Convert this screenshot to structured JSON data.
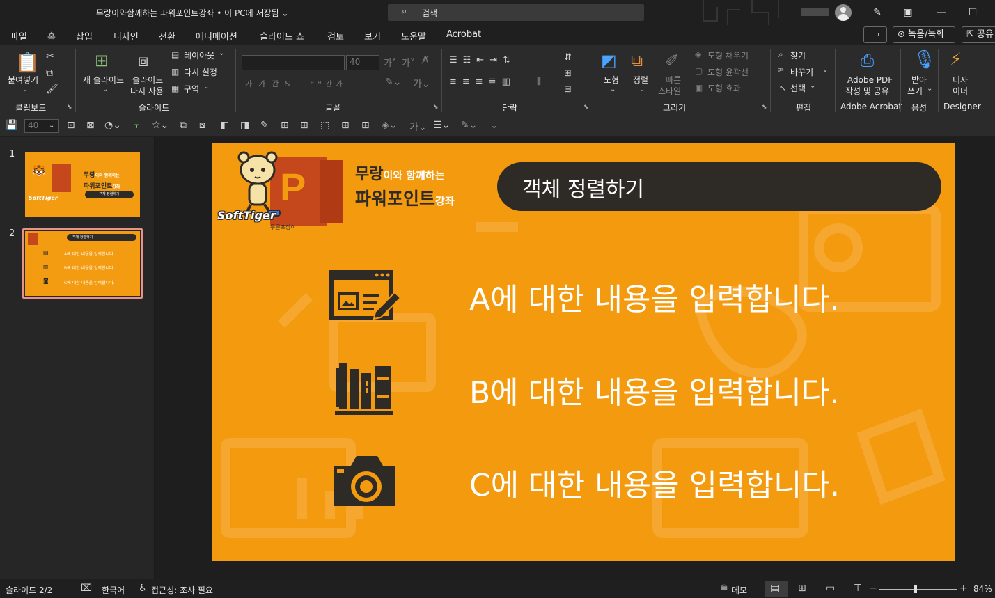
{
  "window": {
    "title": "무랑이와함께하는 파워포인트강좌 • 이 PC에 저장됨",
    "search_placeholder": "검색"
  },
  "menu": {
    "tabs": [
      "파일",
      "홈",
      "삽입",
      "디자인",
      "전환",
      "애니메이션",
      "슬라이드 쇼",
      "검토",
      "보기",
      "도움말",
      "Acrobat"
    ],
    "active_tab": "홈",
    "record_label": "녹음/녹화",
    "share_label": "공유"
  },
  "ribbon": {
    "clipboard": {
      "group": "클립보드",
      "paste": "붙여넣기"
    },
    "slides": {
      "group": "슬라이드",
      "new_slide_1": "새 슬라이드",
      "reuse_1": "슬라이드",
      "reuse_2": "다시 사용",
      "layout": "레이아웃",
      "reset": "다시 설정",
      "section": "구역"
    },
    "font": {
      "group": "글꼴",
      "size": "40"
    },
    "paragraph": {
      "group": "단락"
    },
    "drawing": {
      "group": "그리기",
      "shape": "도형",
      "arrange": "정렬",
      "quick_1": "빠른",
      "quick_2": "스타일",
      "fill": "도형 채우기",
      "outline": "도형 윤곽선",
      "effect": "도형 효과"
    },
    "editing": {
      "group": "편집",
      "find": "찾기",
      "replace": "바꾸기",
      "select": "선택"
    },
    "adobe": {
      "group": "Adobe Acrobat",
      "line1": "Adobe PDF",
      "line2": "작성 및 공유"
    },
    "voice": {
      "group": "음성",
      "line1": "받아",
      "line2": "쓰기"
    },
    "designer": {
      "group": "Designer",
      "line1": "디자",
      "line2": "이너"
    }
  },
  "qat": {
    "size": "40"
  },
  "thumbnails": {
    "slides": [
      {
        "number": "1",
        "title_a": "무랑",
        "title_b": "이와 함께하는",
        "title_c": "파워포인트",
        "title_d": "강좌",
        "pill": "객체 정렬하기",
        "brand": "SoftTiger"
      },
      {
        "number": "2",
        "pill": "객체 정렬하기",
        "line_a": "A에 대한 내용을 입력합니다.",
        "line_b": "B에 대한 내용을 입력합니다.",
        "line_c": "C에 대한 내용을 입력합니다."
      }
    ]
  },
  "slide": {
    "logo_title_big": "무랑",
    "logo_title_small": "이와 함께하는",
    "logo_title_line2": "파워포인트",
    "logo_title_line2_small": "강좌",
    "brand": "SoftTiger",
    "brand_sub": "무른포장이",
    "title": "객체 정렬하기",
    "items": [
      {
        "icon": "edit-document-icon",
        "text": "A에 대한 내용을 입력합니다."
      },
      {
        "icon": "books-icon",
        "text": "B에 대한 내용을 입력합니다."
      },
      {
        "icon": "camera-icon",
        "text": "C에 대한 내용을 입력합니다."
      }
    ],
    "colors": {
      "background": "#f39a0f",
      "dark": "#2e2a26",
      "text": "#ffffff"
    }
  },
  "status": {
    "slide_counter": "슬라이드 2/2",
    "language": "한국어",
    "accessibility": "접근성: 조사 필요",
    "notes": "메모",
    "zoom": "84%"
  }
}
